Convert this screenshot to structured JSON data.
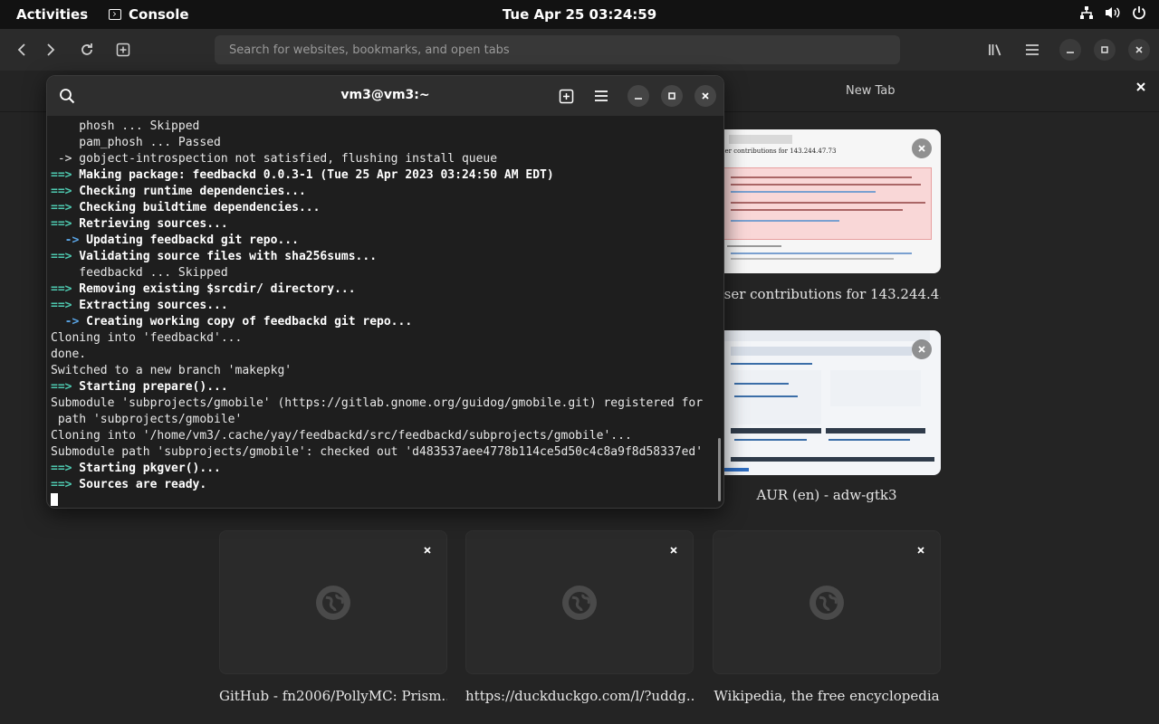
{
  "topbar": {
    "activities": "Activities",
    "app_name": "Console",
    "clock": "Tue Apr 25  03:24:59"
  },
  "browser": {
    "search_placeholder": "Search for websites, bookmarks, and open tabs",
    "tab_title": "New Tab"
  },
  "console": {
    "title": "vm3@vm3:~",
    "lines": [
      {
        "prefix": "",
        "text": "    phosh ... Skipped",
        "style": "plain"
      },
      {
        "prefix": "",
        "text": "    pam_phosh ... Passed",
        "style": "plain"
      },
      {
        "prefix": "",
        "text": " -> gobject-introspection not satisfied, flushing install queue",
        "style": "plain"
      },
      {
        "prefix": "==>",
        "text": " Making package: feedbackd 0.0.3-1 (Tue 25 Apr 2023 03:24:50 AM EDT)",
        "style": "green"
      },
      {
        "prefix": "==>",
        "text": " Checking runtime dependencies...",
        "style": "green"
      },
      {
        "prefix": "==>",
        "text": " Checking buildtime dependencies...",
        "style": "green"
      },
      {
        "prefix": "==>",
        "text": " Retrieving sources...",
        "style": "green"
      },
      {
        "prefix": "  ->",
        "text": " Updating feedbackd git repo...",
        "style": "blue"
      },
      {
        "prefix": "==>",
        "text": " Validating source files with sha256sums...",
        "style": "green"
      },
      {
        "prefix": "",
        "text": "    feedbackd ... Skipped",
        "style": "plain"
      },
      {
        "prefix": "==>",
        "text": " Removing existing $srcdir/ directory...",
        "style": "green"
      },
      {
        "prefix": "==>",
        "text": " Extracting sources...",
        "style": "green"
      },
      {
        "prefix": "  ->",
        "text": " Creating working copy of feedbackd git repo...",
        "style": "blue"
      },
      {
        "prefix": "",
        "text": "Cloning into 'feedbackd'...",
        "style": "plain"
      },
      {
        "prefix": "",
        "text": "done.",
        "style": "plain"
      },
      {
        "prefix": "",
        "text": "Switched to a new branch 'makepkg'",
        "style": "plain"
      },
      {
        "prefix": "==>",
        "text": " Starting prepare()...",
        "style": "green"
      },
      {
        "prefix": "",
        "text": "Submodule 'subprojects/gmobile' (https://gitlab.gnome.org/guidog/gmobile.git) registered for",
        "style": "plain"
      },
      {
        "prefix": "",
        "text": " path 'subprojects/gmobile'",
        "style": "plain"
      },
      {
        "prefix": "",
        "text": "Cloning into '/home/vm3/.cache/yay/feedbackd/src/feedbackd/subprojects/gmobile'...",
        "style": "plain"
      },
      {
        "prefix": "",
        "text": "Submodule path 'subprojects/gmobile': checked out 'd483537aee4778b114ce5d50c4c8a9f8d58337ed'",
        "style": "plain"
      },
      {
        "prefix": "==>",
        "text": " Starting pkgver()...",
        "style": "green"
      },
      {
        "prefix": "==>",
        "text": " Sources are ready.",
        "style": "green"
      }
    ]
  },
  "tiles": [
    {
      "caption": "User contributions for 143.244.4...",
      "kind": "wiki"
    },
    {
      "caption": "AUR (en) - adw-gtk3",
      "kind": "aur"
    },
    {
      "caption": "GitHub - fn2006/PollyMC: Prism...",
      "kind": "empty"
    },
    {
      "caption": "https://duckduckgo.com/l/?uddg...",
      "kind": "empty"
    },
    {
      "caption": "Wikipedia, the free encyclopedia",
      "kind": "empty"
    }
  ],
  "wiki_thumb": {
    "title": "User contributions for 143.244.47.73"
  },
  "icons": {
    "search": "search-icon",
    "new_tab": "new-tab-icon",
    "menu": "hamburger-menu-icon",
    "globe": "globe-icon"
  }
}
